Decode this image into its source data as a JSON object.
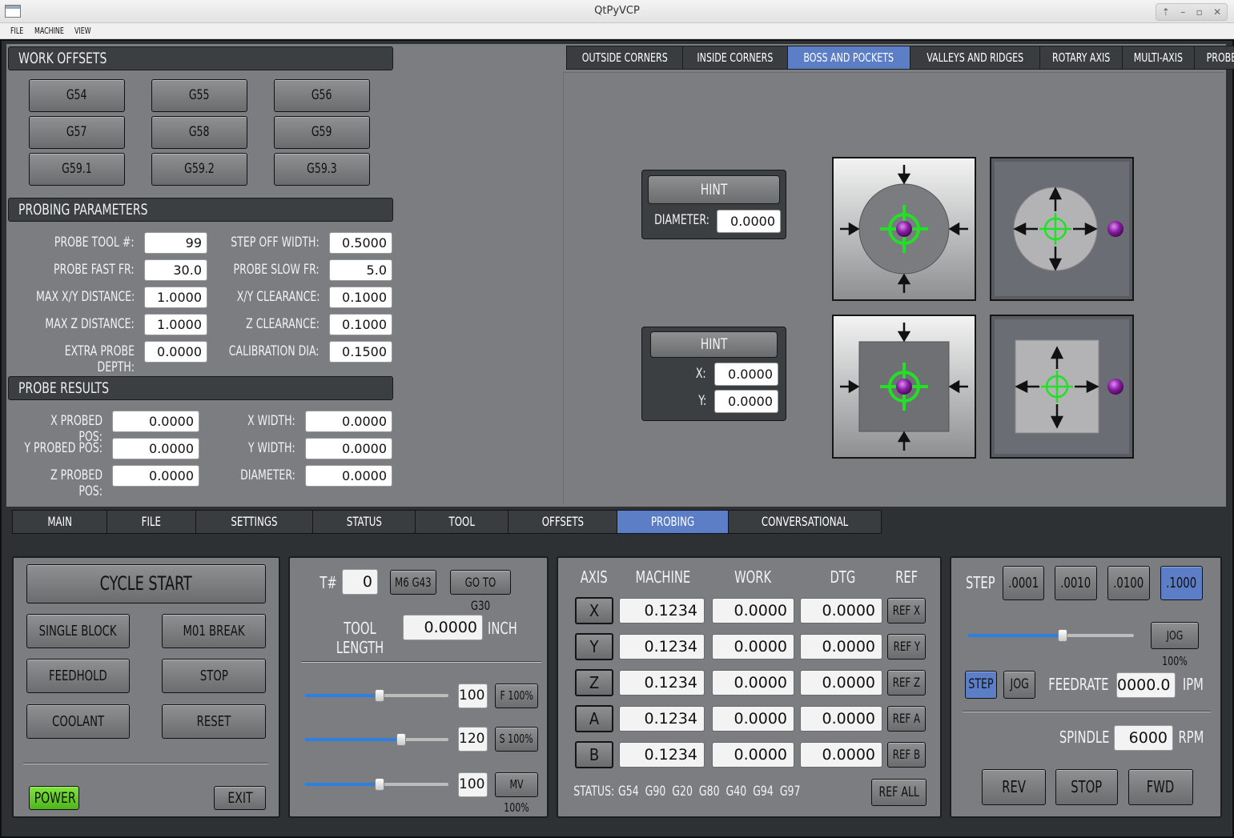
{
  "window": {
    "title": "QtPyVCP",
    "controls": [
      "⇡",
      "–",
      "▫",
      "✕"
    ]
  },
  "menu": [
    "FILE",
    "MACHINE",
    "VIEW"
  ],
  "work_offsets": {
    "header": "WORK OFFSETS",
    "buttons": [
      "G54",
      "G55",
      "G56",
      "G57",
      "G58",
      "G59",
      "G59.1",
      "G59.2",
      "G59.3"
    ]
  },
  "probing_parameters": {
    "header": "PROBING PARAMETERS",
    "left": [
      {
        "label": "PROBE TOOL #:",
        "value": "99"
      },
      {
        "label": "PROBE FAST FR:",
        "value": "30.0"
      },
      {
        "label": "MAX X/Y DISTANCE:",
        "value": "1.0000"
      },
      {
        "label": "MAX Z DISTANCE:",
        "value": "1.0000"
      },
      {
        "label": "EXTRA PROBE DEPTH:",
        "value": "0.0000"
      }
    ],
    "right": [
      {
        "label": "STEP OFF WIDTH:",
        "value": "0.5000"
      },
      {
        "label": "PROBE SLOW FR:",
        "value": "5.0"
      },
      {
        "label": "X/Y CLEARANCE:",
        "value": "0.1000"
      },
      {
        "label": "Z CLEARANCE:",
        "value": "0.1000"
      },
      {
        "label": "CALIBRATION DIA:",
        "value": "0.1500"
      }
    ]
  },
  "probe_results": {
    "header": "PROBE RESULTS",
    "left": [
      {
        "label": "X PROBED POS:",
        "value": "0.0000"
      },
      {
        "label": "Y PROBED POS:",
        "value": "0.0000"
      },
      {
        "label": "Z PROBED POS:",
        "value": "0.0000"
      }
    ],
    "right": [
      {
        "label": "X WIDTH:",
        "value": "0.0000"
      },
      {
        "label": "Y WIDTH:",
        "value": "0.0000"
      },
      {
        "label": "DIAMETER:",
        "value": "0.0000"
      }
    ]
  },
  "probe_tabs": {
    "items": [
      "OUTSIDE CORNERS",
      "INSIDE CORNERS",
      "BOSS AND POCKETS",
      "VALLEYS AND RIDGES",
      "ROTARY AXIS",
      "MULTI-AXIS",
      "PROBE HELP"
    ],
    "active": "BOSS AND POCKETS"
  },
  "hint_circle": {
    "button": "HINT",
    "label": "DIAMETER:",
    "value": "0.0000"
  },
  "hint_rect": {
    "button": "HINT",
    "x_label": "X:",
    "x_value": "0.0000",
    "y_label": "Y:",
    "y_value": "0.0000"
  },
  "main_tabs": {
    "items": [
      "MAIN",
      "FILE",
      "SETTINGS",
      "STATUS",
      "TOOL",
      "OFFSETS",
      "PROBING",
      "CONVERSATIONAL"
    ],
    "active": "PROBING"
  },
  "controls": {
    "cycle_start": "CYCLE START",
    "single_block": "SINGLE BLOCK",
    "m01_break": "M01 BREAK",
    "feedhold": "FEEDHOLD",
    "stop": "STOP",
    "coolant": "COOLANT",
    "reset": "RESET",
    "power": "POWER",
    "exit": "EXIT"
  },
  "tool": {
    "t_label": "T#",
    "t_value": "0",
    "m6_g43": "M6 G43",
    "go_to_g30": "GO TO G30",
    "length_label": "TOOL LENGTH",
    "length_value": "0.0000",
    "length_unit": "INCH"
  },
  "overrides": [
    {
      "value": "100",
      "button": "F 100%",
      "level": 0.52
    },
    {
      "value": "120",
      "button": "S 100%",
      "level": 0.67
    },
    {
      "value": "100",
      "button": "MV 100%",
      "level": 0.52
    }
  ],
  "dro": {
    "headers": [
      "AXIS",
      "MACHINE",
      "WORK",
      "DTG",
      "REF"
    ],
    "rows": [
      {
        "axis": "X",
        "machine": "0.1234",
        "work": "0.0000",
        "dtg": "0.0000",
        "ref": "REF X"
      },
      {
        "axis": "Y",
        "machine": "0.1234",
        "work": "0.0000",
        "dtg": "0.0000",
        "ref": "REF Y"
      },
      {
        "axis": "Z",
        "machine": "0.1234",
        "work": "0.0000",
        "dtg": "0.0000",
        "ref": "REF Z"
      },
      {
        "axis": "A",
        "machine": "0.1234",
        "work": "0.0000",
        "dtg": "0.0000",
        "ref": "REF A"
      },
      {
        "axis": "B",
        "machine": "0.1234",
        "work": "0.0000",
        "dtg": "0.0000",
        "ref": "REF B"
      }
    ],
    "status_label": "STATUS:",
    "status_codes": "G54  G90  G20  G80  G40  G94  G97",
    "ref_all": "REF ALL"
  },
  "jog": {
    "step_label": "STEP",
    "steps": [
      ".0001",
      ".0010",
      ".0100",
      ".1000"
    ],
    "active_step": ".1000",
    "jog_speed": "JOG 100%",
    "jog_level": 0.57,
    "mode_step": "STEP",
    "mode_jog": "JOG",
    "feedrate_label": "FEEDRATE",
    "feedrate_value": "0000.0",
    "feedrate_unit": "IPM",
    "spindle_label": "SPINDLE",
    "spindle_value": "6000",
    "spindle_unit": "RPM",
    "rev": "REV",
    "stop": "STOP",
    "fwd": "FWD"
  },
  "colors": {
    "accent": "#5b7ec6",
    "power": "#6fd12c",
    "probe_target": "#22e026",
    "probe_ball": "#9b2bb5"
  }
}
